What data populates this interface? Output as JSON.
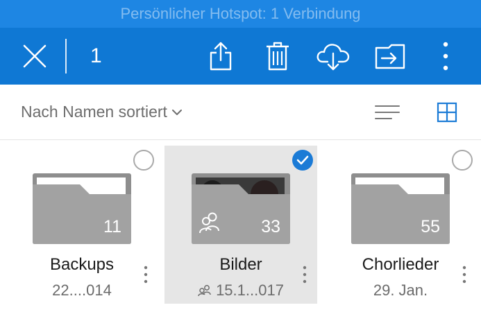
{
  "status": {
    "hotspot_text": "Persönlicher Hotspot: 1 Verbindung"
  },
  "toolbar": {
    "selected_count": "1",
    "actions": [
      "close-icon",
      "share-icon",
      "trash-icon",
      "download-cloud-icon",
      "move-icon",
      "more-vertical-icon"
    ]
  },
  "sort": {
    "label": "Nach Namen sortiert"
  },
  "view": {
    "mode": "grid"
  },
  "colors": {
    "accent": "#0f78d4",
    "status_bar": "#1e86e3",
    "folder": "#a0a0a0",
    "selected_bg": "#e6e6e6"
  },
  "folders": [
    {
      "name": "Backups",
      "count": "11",
      "date": "22....014",
      "shared": false,
      "selected": false
    },
    {
      "name": "Bilder",
      "count": "33",
      "date": "15.1...017",
      "shared": true,
      "selected": true
    },
    {
      "name": "Chorlieder",
      "count": "55",
      "date": "29. Jan.",
      "shared": false,
      "selected": false
    }
  ]
}
